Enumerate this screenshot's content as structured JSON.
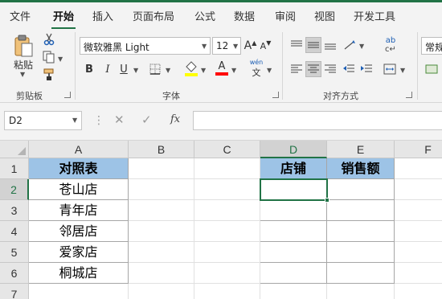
{
  "tabs": [
    "文件",
    "开始",
    "插入",
    "页面布局",
    "公式",
    "数据",
    "审阅",
    "视图",
    "开发工具"
  ],
  "active_tab": "开始",
  "ribbon": {
    "clipboard": {
      "paste_label": "粘贴",
      "group_label": "剪贴板"
    },
    "font": {
      "font_name": "微软雅黑 Light",
      "font_size": "12",
      "group_label": "字体",
      "bold": "B",
      "italic": "I",
      "underline": "U",
      "grow": "A",
      "shrink": "A"
    },
    "alignment": {
      "group_label": "对齐方式"
    },
    "number": {
      "format_value": "常规"
    },
    "colors": {
      "highlight": "#ffff00",
      "font_color": "#ff0000",
      "accent": "#217346"
    }
  },
  "formula_bar": {
    "name_box": "D2",
    "fx": "fx",
    "value": ""
  },
  "sheet": {
    "columns": [
      "A",
      "B",
      "C",
      "D",
      "E",
      "F"
    ],
    "rows": [
      "1",
      "2",
      "3",
      "4",
      "5",
      "6",
      "7"
    ],
    "active_cell": "D2",
    "cells": {
      "A1": "对照表",
      "A2": "苍山店",
      "A3": "青年店",
      "A4": "邻居店",
      "A5": "爱家店",
      "A6": "桐城店",
      "D1": "店铺",
      "E1": "销售额"
    },
    "header_fill": "#9dc3e6"
  }
}
